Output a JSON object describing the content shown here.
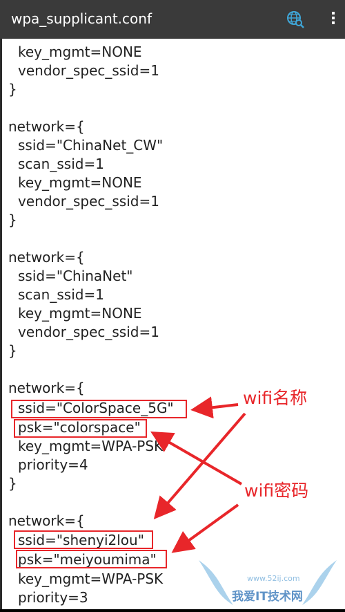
{
  "app_bar": {
    "title": "wpa_supplicant.conf",
    "search_icon": "globe-search-icon",
    "overflow_icon": "vertical-dots-icon"
  },
  "lines": [
    "key_mgmt=NONE",
    "vendor_spec_ssid=1",
    "}",
    "network={",
    "ssid=\"ChinaNet_CW\"",
    "scan_ssid=1",
    "key_mgmt=NONE",
    "vendor_spec_ssid=1",
    "}",
    "network={",
    "ssid=\"ChinaNet\"",
    "scan_ssid=1",
    "key_mgmt=NONE",
    "vendor_spec_ssid=1",
    "}",
    "network={",
    "ssid=\"ColorSpace_5G\"",
    "psk=\"colorspace\"",
    "key_mgmt=WPA-PSK",
    "priority=4",
    "}",
    "network={",
    "ssid=\"shenyi2lou\"",
    "psk=\"meiyoumima\"",
    "key_mgmt=WPA-PSK",
    "priority=3"
  ],
  "annotations": {
    "wifi_name": "wifi名称",
    "wifi_password": "wifi密码"
  },
  "watermark": {
    "text": "我爱IT技术网",
    "url": "www.52ij.com"
  },
  "colors": {
    "annotation_red": "#e8262a",
    "app_bar_bg": "#3a3a3a"
  }
}
